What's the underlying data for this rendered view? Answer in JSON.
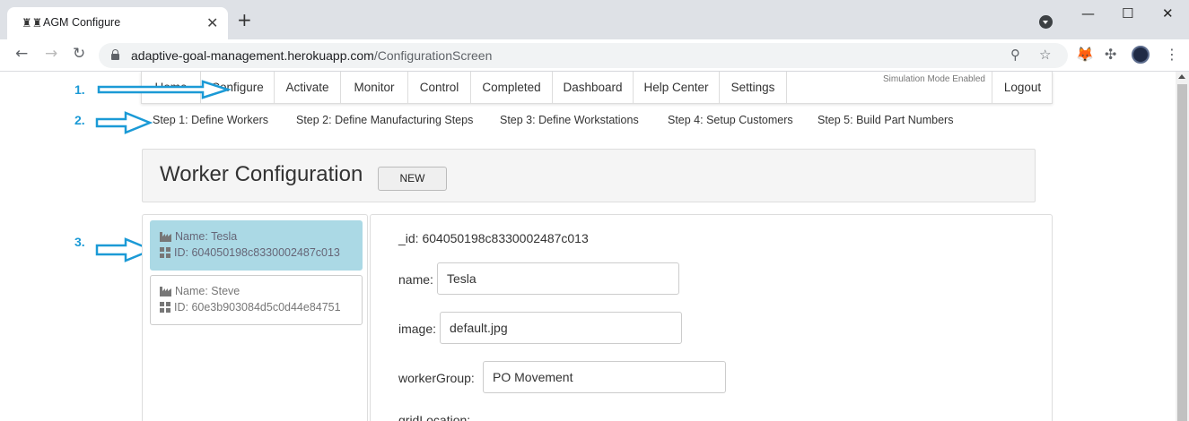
{
  "browser": {
    "tab_title": "AGM Configure",
    "url_host": "adaptive-goal-management.herokuapp.com",
    "url_path": "/ConfigurationScreen"
  },
  "nav": {
    "items": [
      "Home",
      "Configure",
      "Activate",
      "Monitor",
      "Control",
      "Completed",
      "Dashboard",
      "Help Center",
      "Settings"
    ],
    "simulation_mode": "Simulation Mode Enabled",
    "logout": "Logout"
  },
  "steps": [
    "Step 1: Define Workers",
    "Step 2: Define Manufacturing Steps",
    "Step 3: Define Workstations",
    "Step 4: Setup Customers",
    "Step 5: Build Part Numbers"
  ],
  "annotations": [
    "1.",
    "2.",
    "3."
  ],
  "annotation_color": "#1b9ad6",
  "config": {
    "title": "Worker Configuration",
    "new_button": "NEW"
  },
  "workers": [
    {
      "name": "Name: Tesla",
      "id": "ID: 604050198c8330002487c013",
      "selected": true
    },
    {
      "name": "Name: Steve",
      "id": "ID: 60e3b903084d5c0d44e84751",
      "selected": false
    }
  ],
  "selected_color": "#abd9e5",
  "detail": {
    "id_line": "_id: 604050198c8330002487c013",
    "name_label": "name:",
    "name_value": "Tesla",
    "image_label": "image:",
    "image_value": "default.jpg",
    "worker_group_label": "workerGroup:",
    "worker_group_value": "PO Movement",
    "grid_location_label": "gridLocation:"
  }
}
